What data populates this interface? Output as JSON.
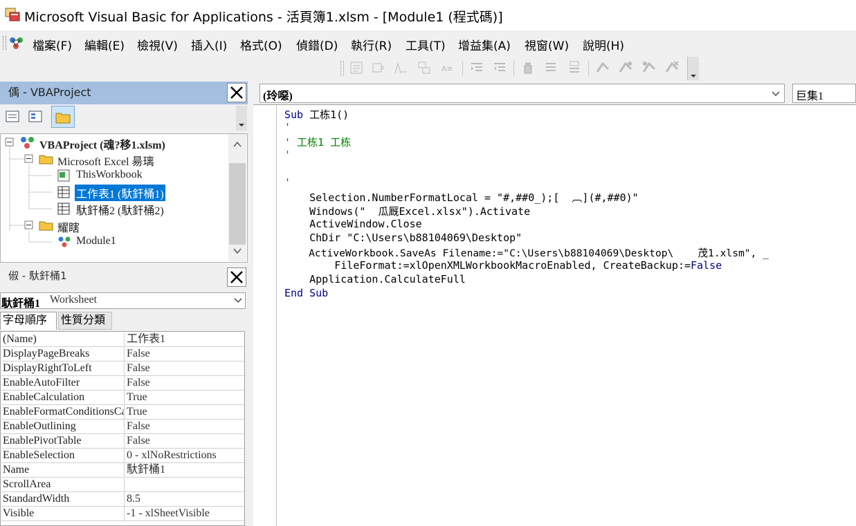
{
  "window": {
    "title": "Microsoft Visual Basic for Applications - 活頁簿1.xlsm - [Module1 (程式碼)]",
    "app_icon": "vba-app-icon"
  },
  "menu": {
    "items": [
      "檔案(F)",
      "編輯(E)",
      "檢視(V)",
      "插入(I)",
      "格式(O)",
      "偵錯(D)",
      "執行(R)",
      "工具(T)",
      "增益集(A)",
      "視窗(W)",
      "說明(H)"
    ]
  },
  "toolbar": {
    "icons": [
      "list-properties-icon",
      "list-constants-icon",
      "quick-info-icon",
      "parameter-info-icon",
      "complete-word-icon",
      "indent-icon",
      "outdent-icon",
      "breakpoint-hand-icon",
      "comment-block-icon",
      "uncomment-block-icon",
      "toggle-bookmark-icon",
      "next-bookmark-icon",
      "previous-bookmark-icon",
      "clear-bookmarks-icon"
    ]
  },
  "project_pane": {
    "title": "偊 - VBAProject",
    "tree": {
      "root": "VBAProject (魂?移1.xlsm)",
      "excel_objects_folder": "Microsoft Excel 昜璃",
      "this_workbook": "ThisWorkbook",
      "sheet1": "工作表1 (馱釬桶1)",
      "sheet2": "馱釬桶2 (馱釬桶2)",
      "modules_folder": "耀瞎",
      "module1": "Module1"
    }
  },
  "properties_pane": {
    "title": "俶 - 馱釬桶1",
    "combo_name": "馱釬桶1",
    "combo_type": "Worksheet",
    "tab_alpha": "字母順序",
    "tab_category": "性質分類",
    "rows": [
      {
        "name": "(Name)",
        "value": "工作表1"
      },
      {
        "name": "DisplayPageBreaks",
        "value": "False"
      },
      {
        "name": "DisplayRightToLeft",
        "value": "False"
      },
      {
        "name": "EnableAutoFilter",
        "value": "False"
      },
      {
        "name": "EnableCalculation",
        "value": "True"
      },
      {
        "name": "EnableFormatConditionsCalculation",
        "value": "True"
      },
      {
        "name": "EnableOutlining",
        "value": "False"
      },
      {
        "name": "EnablePivotTable",
        "value": "False"
      },
      {
        "name": "EnableSelection",
        "value": "0 - xlNoRestrictions"
      },
      {
        "name": "Name",
        "value": "馱釬桶1"
      },
      {
        "name": "ScrollArea",
        "value": ""
      },
      {
        "name": "StandardWidth",
        "value": "8.5"
      },
      {
        "name": "Visible",
        "value": "-1 - xlSheetVisible"
      }
    ]
  },
  "code_window": {
    "object_combo": "(玲噁)",
    "procedure_combo": "巨集1",
    "lines": {
      "l1_kw": "Sub",
      "l1_rest": " 工栋1()",
      "l2": "'",
      "l3": "' 工栋1 工栋",
      "l4": "'",
      "l5": "",
      "l6": "'",
      "l7": "    Selection.NumberFormatLocal = \"#,##0_);[  ︹](#,##0)\"",
      "l8": "    Windows(\"  瓜厩Excel.xlsx\").Activate",
      "l9": "    ActiveWindow.Close",
      "l10": "    ChDir \"C:\\Users\\b88104069\\Desktop\"",
      "l11": "    ActiveWorkbook.SaveAs Filename:=\"C:\\Users\\b88104069\\Desktop\\    茂1.xlsm\", _",
      "l12_pre": "        FileFormat:=xlOpenXMLWorkbookMacroEnabled, CreateBackup:=",
      "l12_kw": "False",
      "l13": "    Application.CalculateFull",
      "l14_kw1": "End",
      "l14_kw2": "Sub"
    }
  }
}
